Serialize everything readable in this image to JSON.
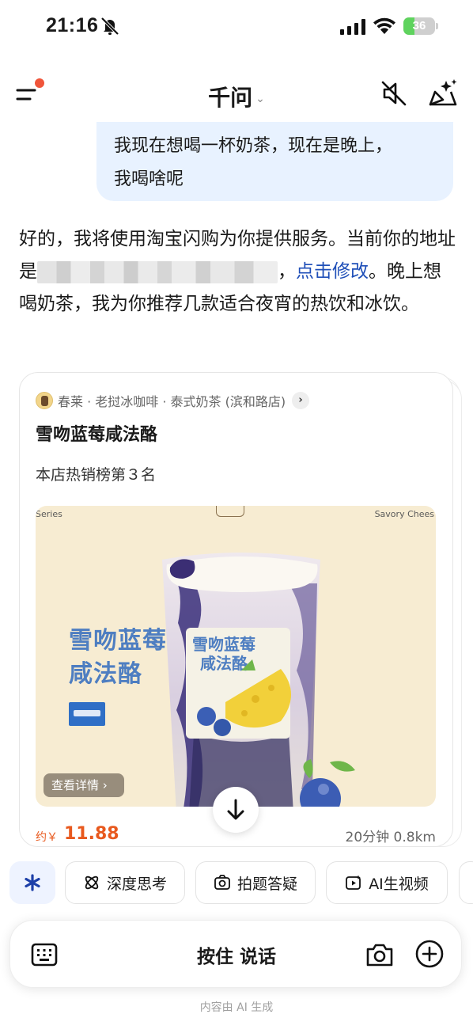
{
  "status_bar": {
    "time": "21:16",
    "battery": "36",
    "battery_level": 0.36
  },
  "header": {
    "title": "千问",
    "title_chevron": "⌄"
  },
  "conversation": {
    "user_message": [
      "我现在想喝一杯奶茶，现在是晚上，",
      "我喝啥呢"
    ],
    "assistant_reply": {
      "part1": "好的，我将使用淘宝闪购为你提供服务。当前你的地址是",
      "part2": "，",
      "link": "点击修改",
      "part3": "。晚上想喝奶茶，我为你推荐几款适合夜宵的热饮和冰饮。"
    }
  },
  "product_card": {
    "shop_name": "春莱 · 老挝冰咖啡 · 泰式奶茶 (滨和路店)",
    "shop_arrow": "›",
    "title": "雪吻蓝莓咸法酪",
    "rank": "本店热销榜第３名",
    "image": {
      "corner_left": "Series",
      "corner_right": "Savory Chees",
      "name_lines": [
        "雪吻蓝莓",
        "咸法酪"
      ],
      "cup_text_lines": [
        "雪吻蓝莓",
        "咸法酪"
      ]
    },
    "detail_button": "查看详情 ›",
    "price_prefix": "约￥",
    "price": "11.88",
    "delivery": "20分钟 0.8km"
  },
  "chips": [
    {
      "label": "深度思考",
      "icon": "atom-icon"
    },
    {
      "label": "拍题答疑",
      "icon": "camera-scan-icon"
    },
    {
      "label": "AI生视频",
      "icon": "video-icon"
    }
  ],
  "input_bar": {
    "hold_to_talk": "按住 说话"
  },
  "footer": {
    "note": "内容由 AI 生成"
  },
  "colors": {
    "accent_blue": "#1f4fb8",
    "price_orange": "#e8591e",
    "user_bubble": "#e8f2ff",
    "notification_dot": "#f0553a"
  }
}
